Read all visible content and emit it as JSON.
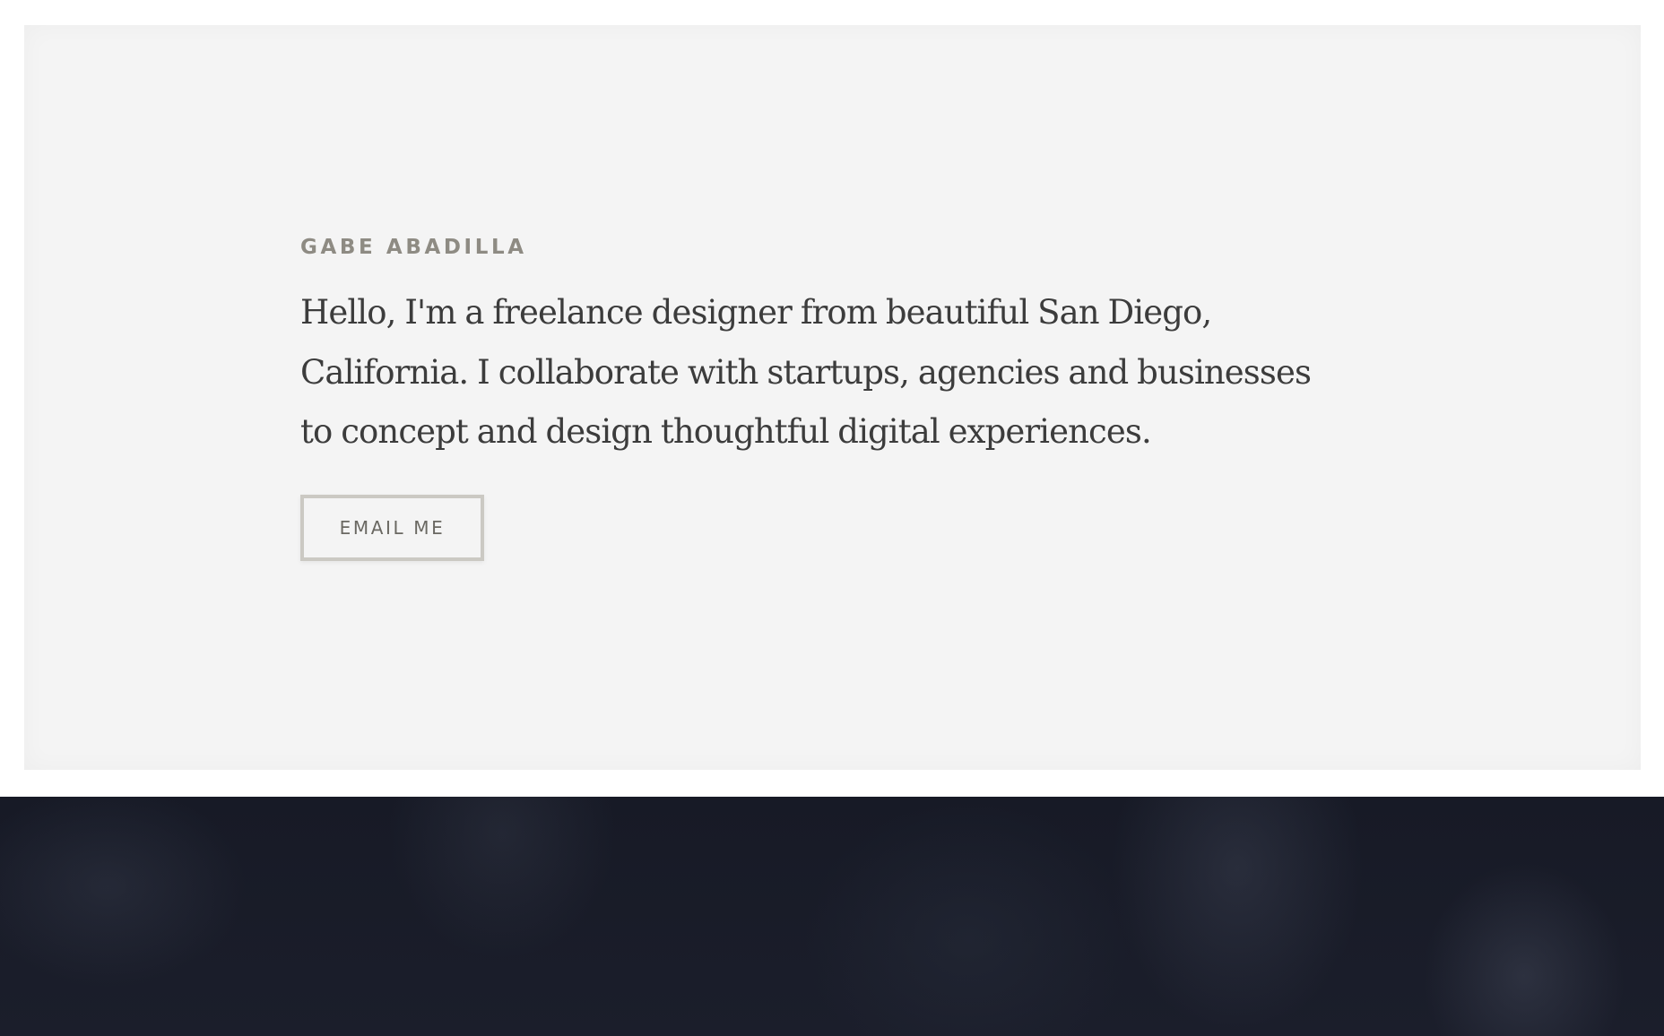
{
  "intro": {
    "name": "GABE ABADILLA",
    "bio": "Hello, I'm a freelance designer from beautiful San Diego, California. I collaborate with startups, agencies and businesses to concept and design thoughtful digital experiences.",
    "email_button_label": "EMAIL ME"
  },
  "colors": {
    "card_background": "#f4f4f4",
    "name_text": "#8e8b83",
    "bio_text": "#3c3c3c",
    "button_border": "#cbc9c3",
    "dark_band": "#171a26"
  }
}
